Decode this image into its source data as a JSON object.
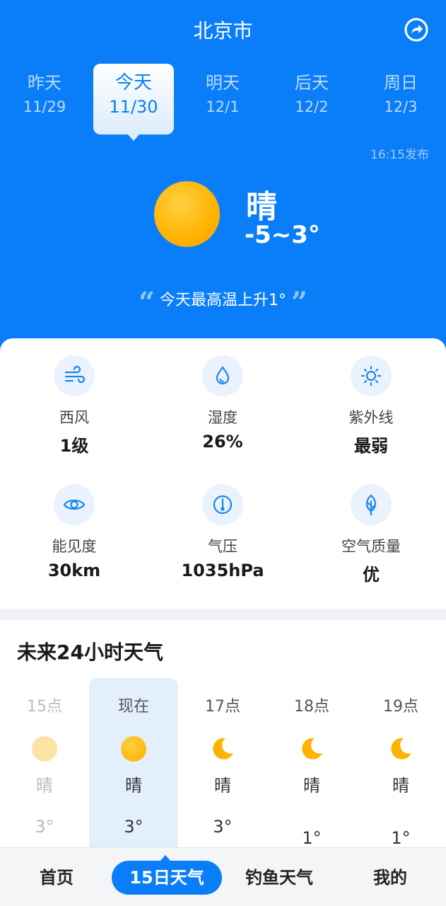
{
  "header": {
    "city": "北京市",
    "share_icon": "share-icon"
  },
  "days": [
    {
      "name": "昨天",
      "date": "11/29"
    },
    {
      "name": "今天",
      "date": "11/30"
    },
    {
      "name": "明天",
      "date": "12/1"
    },
    {
      "name": "后天",
      "date": "12/2"
    },
    {
      "name": "周日",
      "date": "12/3"
    }
  ],
  "publish_time": "16:15发布",
  "current": {
    "condition": "晴",
    "temp_range": "-5~3°",
    "tip": "今天最高温上升1°",
    "icon": "sun-icon"
  },
  "metrics": [
    {
      "label": "西风",
      "value": "1级",
      "icon": "wind-icon"
    },
    {
      "label": "湿度",
      "value": "26%",
      "icon": "humidity-icon"
    },
    {
      "label": "紫外线",
      "value": "最弱",
      "icon": "uv-icon"
    },
    {
      "label": "能见度",
      "value": "30km",
      "icon": "eye-icon"
    },
    {
      "label": "气压",
      "value": "1035hPa",
      "icon": "pressure-icon"
    },
    {
      "label": "空气质量",
      "value": "优",
      "icon": "leaf-icon"
    }
  ],
  "hourly": {
    "title": "未来24小时天气",
    "items": [
      {
        "time": "15点",
        "condition": "晴",
        "temp": "3°",
        "icon": "sun-icon"
      },
      {
        "time": "现在",
        "condition": "晴",
        "temp": "3°",
        "icon": "sun-icon"
      },
      {
        "time": "17点",
        "condition": "晴",
        "temp": "3°",
        "icon": "moon-icon"
      },
      {
        "time": "18点",
        "condition": "晴",
        "temp": "1°",
        "icon": "moon-icon"
      },
      {
        "time": "19点",
        "condition": "晴",
        "temp": "1°",
        "icon": "moon-icon"
      }
    ]
  },
  "nav": [
    {
      "label": "首页"
    },
    {
      "label": "15日天气"
    },
    {
      "label": "钓鱼天气"
    },
    {
      "label": "我的"
    }
  ],
  "colors": {
    "primary": "#0a7ef8",
    "sun": "#ffb300"
  }
}
